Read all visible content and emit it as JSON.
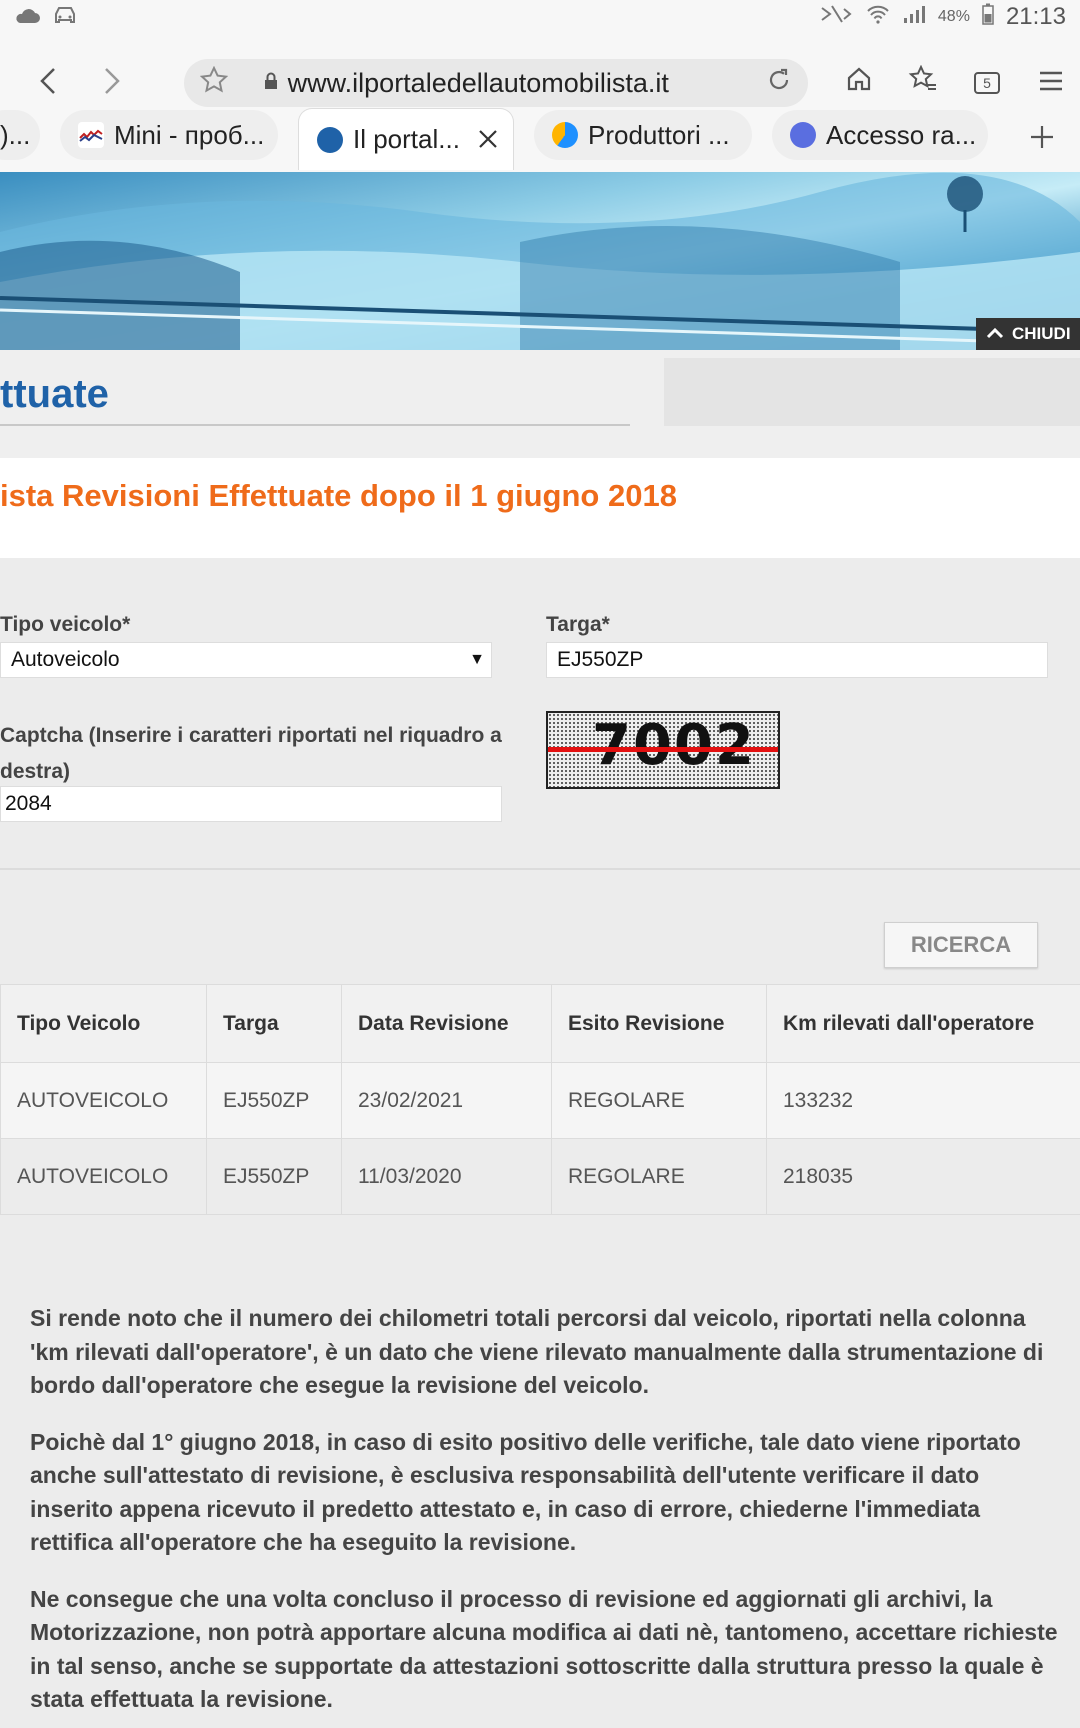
{
  "status_bar": {
    "battery": "48%",
    "time": "21:13"
  },
  "browser": {
    "url": "www.ilportaledellautomobilista.it",
    "tab_count": "5",
    "tabs": [
      {
        "label": ")..."
      },
      {
        "label": "Mini - проб..."
      },
      {
        "label": "Il portal..."
      },
      {
        "label": "Produttori ..."
      },
      {
        "label": "Accesso ra..."
      }
    ]
  },
  "banner": {
    "close_label": "CHIUDI"
  },
  "page": {
    "title": "ttuate",
    "section_title": "ista Revisioni Effettuate dopo il 1 giugno 2018"
  },
  "form": {
    "vehicle_type_label": "Tipo veicolo*",
    "vehicle_type_value": "Autoveicolo",
    "plate_label": "Targa*",
    "plate_value": "EJ550ZP",
    "captcha_label_line1": "Captcha (Inserire i caratteri riportati nel riquadro a",
    "captcha_label_line2": "destra)",
    "captcha_value": "2084",
    "captcha_image_text": "7002",
    "search_button": "RICERCA"
  },
  "table": {
    "headers": [
      "Tipo Veicolo",
      "Targa",
      "Data Revisione",
      "Esito Revisione",
      "Km rilevati dall'operatore"
    ],
    "rows": [
      [
        "AUTOVEICOLO",
        "EJ550ZP",
        "23/02/2021",
        "REGOLARE",
        "133232"
      ],
      [
        "AUTOVEICOLO",
        "EJ550ZP",
        "11/03/2020",
        "REGOLARE",
        "218035"
      ]
    ]
  },
  "notes": [
    "Si rende noto che il numero dei chilometri totali percorsi dal veicolo, riportati nella colonna 'km rilevati dall'operatore', è un dato che viene rilevato manualmente dalla strumentazione di bordo dall'operatore che esegue la revisione del veicolo.",
    "Poichè dal 1° giugno 2018, in caso di esito positivo delle verifiche, tale dato viene riportato anche sull'attestato di revisione, è esclusiva responsabilità dell'utente verificare il dato inserito appena ricevuto il predetto attestato e, in caso di errore, chiederne l'immediata rettifica all'operatore che ha eseguito la revisione.",
    "Ne consegue che una volta concluso il processo di revisione ed aggiornati gli archivi, la Motorizzazione, non potrà apportare alcuna modifica ai dati nè, tantomeno, accettare richieste in tal senso, anche se supportate da attestazioni sottoscritte dalla struttura presso la quale è stata effettuata la revisione."
  ]
}
